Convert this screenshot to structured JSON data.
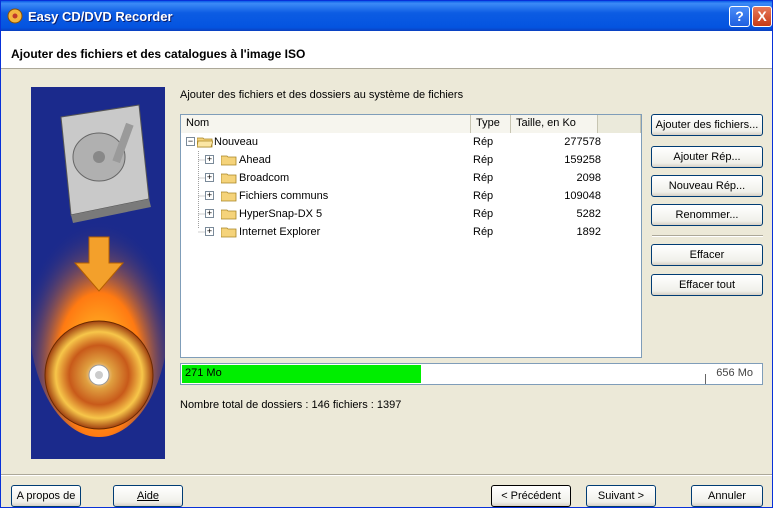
{
  "window": {
    "title": "Easy CD/DVD Recorder"
  },
  "caption_buttons": {
    "help": "?",
    "close": "X"
  },
  "header": {
    "title": "Ajouter des fichiers et des catalogues à l'image ISO"
  },
  "main": {
    "intro": "Ajouter des fichiers et des dossiers au système de fichiers",
    "columns": {
      "name": "Nom",
      "type": "Type",
      "size": "Taille, en Ko"
    },
    "root": {
      "name": "Nouveau",
      "type": "Rép",
      "size": "277578"
    },
    "items": [
      {
        "name": "Ahead",
        "type": "Rép",
        "size": "159258"
      },
      {
        "name": "Broadcom",
        "type": "Rép",
        "size": "2098"
      },
      {
        "name": "Fichiers communs",
        "type": "Rép",
        "size": "109048"
      },
      {
        "name": "HyperSnap-DX 5",
        "type": "Rép",
        "size": "5282"
      },
      {
        "name": "Internet Explorer",
        "type": "Rép",
        "size": "1892"
      }
    ]
  },
  "buttons": {
    "add_files": "Ajouter des fichiers...",
    "add_dir": "Ajouter Rép...",
    "new_dir": "Nouveau Rép...",
    "rename": "Renommer...",
    "delete": "Effacer",
    "delete_all": "Effacer tout"
  },
  "progress": {
    "used": "271 Mo",
    "total": "656 Mo",
    "fraction": 0.413,
    "color": "#00ee00"
  },
  "summary": "Nombre total de dossiers : 146   fichiers : 1397",
  "footer": {
    "about": "A propos de",
    "help": "Aide",
    "previous": "< Précédent",
    "next": "Suivant >",
    "cancel": "Annuler"
  },
  "icons": [
    "app-icon",
    "hard-drive-icon",
    "arrow-down-icon",
    "burning-disc-icon",
    "folder-icon",
    "expand-icon",
    "collapse-icon"
  ]
}
